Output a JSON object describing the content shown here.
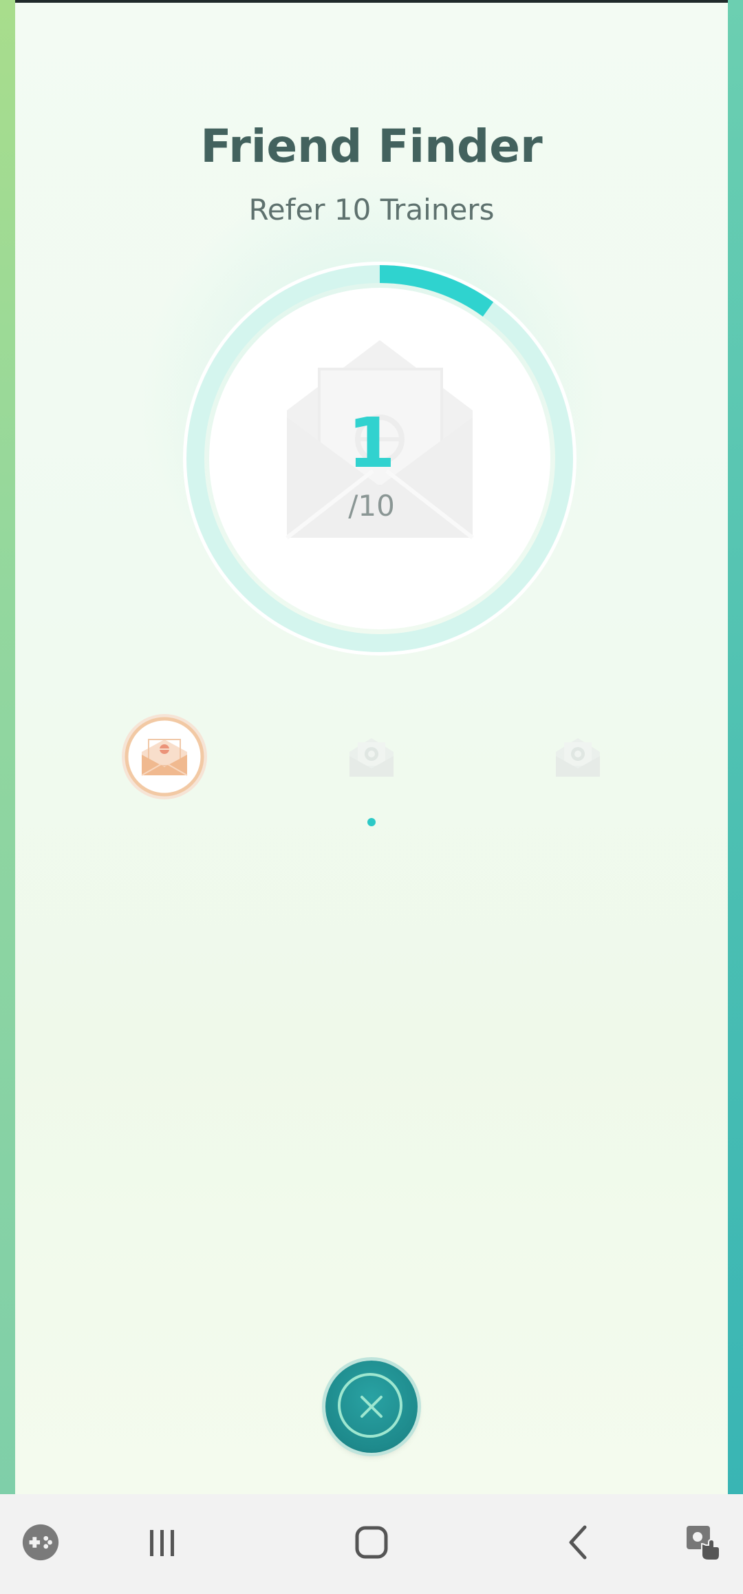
{
  "screen": {
    "title": "Friend Finder",
    "subtitle": "Refer 10 Trainers"
  },
  "progress": {
    "current": "1",
    "total_label": "/10",
    "fraction": 0.1
  },
  "reward_tiers": [
    {
      "name": "bronze",
      "status": "achieved"
    },
    {
      "name": "silver",
      "status": "locked"
    },
    {
      "name": "gold",
      "status": "locked"
    }
  ],
  "pager": {
    "active_page": 1,
    "page_count": 1
  },
  "actions": {
    "close_icon": "close-icon"
  },
  "navbar": {
    "items": [
      "game-launcher-icon",
      "recent-apps-icon",
      "home-icon",
      "back-icon",
      "assistant-icon"
    ]
  },
  "colors": {
    "accent": "#31d2cf",
    "title": "#43625e",
    "close_button": "#1e8a8c",
    "bronze_medal": "#f2c9a4"
  }
}
